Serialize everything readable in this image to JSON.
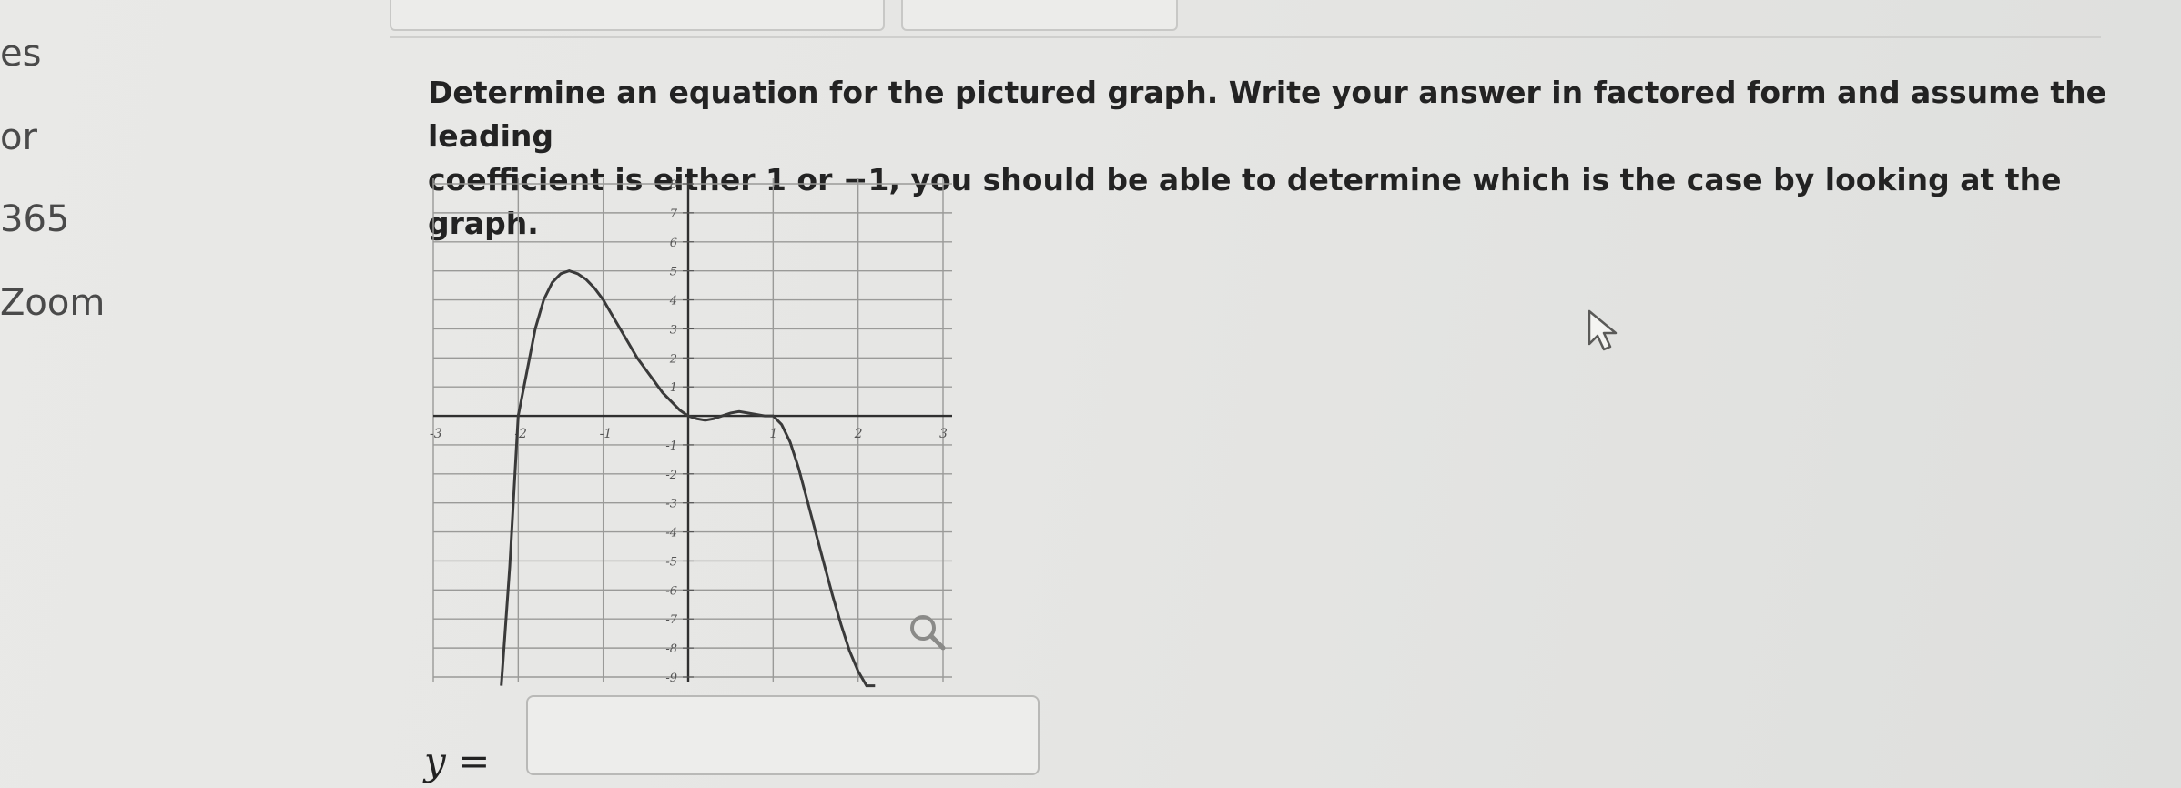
{
  "sidebar": {
    "items": [
      {
        "label": "es"
      },
      {
        "label": "or"
      },
      {
        "label": "365"
      },
      {
        "label": "Zoom"
      }
    ]
  },
  "question": {
    "line1": "Determine an equation for the pictured graph. Write your answer in factored form and assume the leading",
    "line2": "coefficient is either 1 or −1, you should be able to determine which is the case by looking at the graph."
  },
  "chart_data": {
    "type": "line",
    "title": "",
    "xlabel": "",
    "ylabel": "",
    "xlim": [
      -3,
      3
    ],
    "ylim": [
      -9,
      8
    ],
    "grid": true,
    "x_ticks": [
      -3,
      -2,
      -1,
      1,
      2,
      3
    ],
    "y_ticks": [
      8,
      7,
      6,
      5,
      4,
      3,
      2,
      1,
      -1,
      -2,
      -3,
      -4,
      -5,
      -6,
      -7,
      -8,
      -9
    ],
    "series": [
      {
        "x": [
          -2.2,
          -2.1,
          -2.0,
          -1.9,
          -1.8,
          -1.7,
          -1.6,
          -1.5,
          -1.4,
          -1.3,
          -1.2,
          -1.1,
          -1.0,
          -0.9,
          -0.8,
          -0.7,
          -0.6,
          -0.5,
          -0.4,
          -0.3,
          -0.2,
          -0.1,
          0.0,
          0.1,
          0.2,
          0.3,
          0.4,
          0.5,
          0.6,
          0.7,
          0.8,
          0.9,
          1.0,
          1.1,
          1.2,
          1.3,
          1.4,
          1.5,
          1.6,
          1.7,
          1.8,
          1.9,
          2.0,
          2.1,
          2.2
        ],
        "y": [
          -9.5,
          -5.2,
          0.0,
          1.5,
          3.0,
          4.0,
          4.6,
          4.9,
          5.0,
          4.9,
          4.7,
          4.4,
          4.0,
          3.5,
          3.0,
          2.5,
          2.0,
          1.6,
          1.2,
          0.8,
          0.5,
          0.2,
          0.0,
          -0.1,
          -0.15,
          -0.1,
          0.0,
          0.1,
          0.15,
          0.1,
          0.05,
          0.0,
          0.0,
          -0.3,
          -0.9,
          -1.8,
          -2.9,
          -4.0,
          -5.1,
          -6.2,
          -7.2,
          -8.1,
          -8.8,
          -9.3,
          -9.6
        ]
      }
    ]
  },
  "answer": {
    "label": "y ="
  },
  "icons": {
    "cursor": "mouse-pointer-icon",
    "zoom": "magnifier-icon"
  }
}
